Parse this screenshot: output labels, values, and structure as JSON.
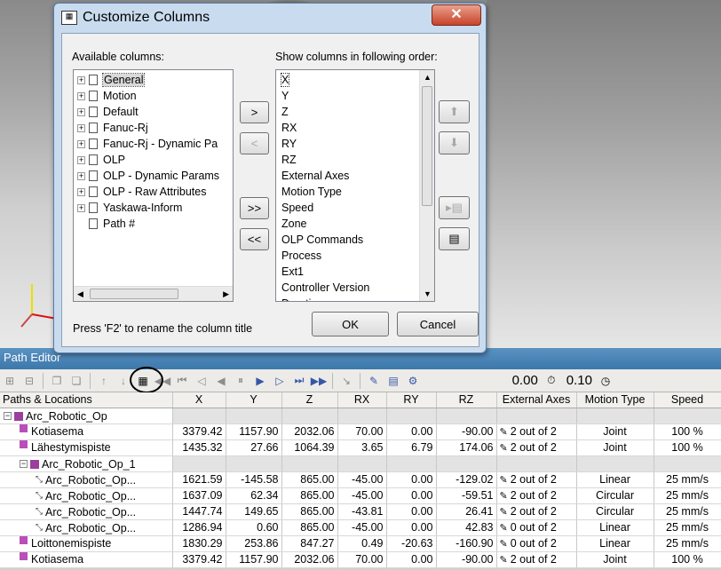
{
  "dialog": {
    "title": "Customize Columns",
    "close_label": "✕",
    "available_label": "Available columns:",
    "order_label": "Show columns in following order:",
    "available": [
      "General",
      "Motion",
      "Default",
      "Fanuc-Rj",
      "Fanuc-Rj - Dynamic Pa",
      "OLP",
      "OLP - Dynamic Params",
      "OLP - Raw Attributes",
      "Yaskawa-Inform",
      "Path #"
    ],
    "order": [
      "X",
      "Y",
      "Z",
      "RX",
      "RY",
      "RZ",
      "External Axes",
      "Motion Type",
      "Speed",
      "Zone",
      "OLP Commands",
      "Process",
      "Ext1",
      "Controller Version",
      "Duration"
    ],
    "add_label": ">",
    "remove_label": "<",
    "add_all_label": ">>",
    "remove_all_label": "<<",
    "hint": "Press 'F2' to rename the column title",
    "ok_label": "OK",
    "cancel_label": "Cancel"
  },
  "editor": {
    "title": "Path Editor",
    "time_value": "0.00",
    "step_value": "0.10",
    "columns": [
      "Paths & Locations",
      "X",
      "Y",
      "Z",
      "RX",
      "RY",
      "RZ",
      "External Axes",
      "Motion Type",
      "Speed"
    ],
    "rows": [
      {
        "name": "Arc_Robotic_Op",
        "x": "",
        "y": "",
        "z": "",
        "rx": "",
        "ry": "",
        "rz": "",
        "ext": "",
        "motion": "",
        "speed": ""
      },
      {
        "name": "Kotiasema",
        "x": "3379.42",
        "y": "1157.90",
        "z": "2032.06",
        "rx": "70.00",
        "ry": "0.00",
        "rz": "-90.00",
        "ext": "2 out of 2",
        "motion": "Joint",
        "speed": "100 %"
      },
      {
        "name": "Lähestymispiste",
        "x": "1435.32",
        "y": "27.66",
        "z": "1064.39",
        "rx": "3.65",
        "ry": "6.79",
        "rz": "174.06",
        "ext": "2 out of 2",
        "motion": "Joint",
        "speed": "100 %"
      },
      {
        "name": "Arc_Robotic_Op_1",
        "x": "",
        "y": "",
        "z": "",
        "rx": "",
        "ry": "",
        "rz": "",
        "ext": "",
        "motion": "",
        "speed": ""
      },
      {
        "name": "Arc_Robotic_Op...",
        "x": "1621.59",
        "y": "-145.58",
        "z": "865.00",
        "rx": "-45.00",
        "ry": "0.00",
        "rz": "-129.02",
        "ext": "2 out of 2",
        "motion": "Linear",
        "speed": "25 mm/s"
      },
      {
        "name": "Arc_Robotic_Op...",
        "x": "1637.09",
        "y": "62.34",
        "z": "865.00",
        "rx": "-45.00",
        "ry": "0.00",
        "rz": "-59.51",
        "ext": "2 out of 2",
        "motion": "Circular",
        "speed": "25 mm/s"
      },
      {
        "name": "Arc_Robotic_Op...",
        "x": "1447.74",
        "y": "149.65",
        "z": "865.00",
        "rx": "-43.81",
        "ry": "0.00",
        "rz": "26.41",
        "ext": "2 out of 2",
        "motion": "Circular",
        "speed": "25 mm/s"
      },
      {
        "name": "Arc_Robotic_Op...",
        "x": "1286.94",
        "y": "0.60",
        "z": "865.00",
        "rx": "-45.00",
        "ry": "0.00",
        "rz": "42.83",
        "ext": "0 out of 2",
        "motion": "Linear",
        "speed": "25 mm/s"
      },
      {
        "name": "Loittonemispiste",
        "x": "1830.29",
        "y": "253.86",
        "z": "847.27",
        "rx": "0.49",
        "ry": "-20.63",
        "rz": "-160.90",
        "ext": "0 out of 2",
        "motion": "Linear",
        "speed": "25 mm/s"
      },
      {
        "name": "Kotiasema",
        "x": "3379.42",
        "y": "1157.90",
        "z": "2032.06",
        "rx": "70.00",
        "ry": "0.00",
        "rz": "-90.00",
        "ext": "2 out of 2",
        "motion": "Joint",
        "speed": "100 %"
      }
    ]
  }
}
